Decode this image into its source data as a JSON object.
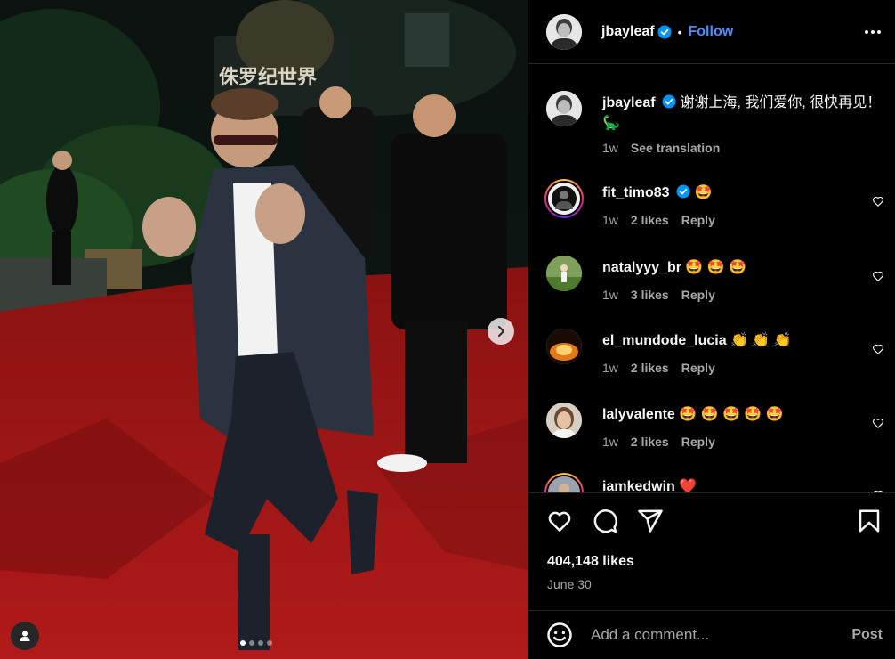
{
  "post": {
    "author": "jbayleaf",
    "follow_label": "Follow",
    "separator": "•",
    "caption_author": "jbayleaf",
    "caption_text": "谢谢上海, 我们爱你, 很快再见！ 🦕",
    "caption_age": "1w",
    "see_translation": "See translation",
    "likes": "404,148 likes",
    "date": "June 30",
    "carousel": {
      "count": 4,
      "active_index": 0
    }
  },
  "photo": {
    "sign_text": "侏罗纪世界"
  },
  "comments": [
    {
      "user": "fit_timo83",
      "verified": true,
      "text": "🤩",
      "age": "1w",
      "likes": "2 likes",
      "reply": "Reply",
      "story_ring": true
    },
    {
      "user": "natalyyy_br",
      "verified": false,
      "text": "🤩 🤩 🤩",
      "age": "1w",
      "likes": "3 likes",
      "reply": "Reply",
      "story_ring": false
    },
    {
      "user": "el_mundode_lucia",
      "verified": false,
      "text": "👏 👏 👏",
      "age": "1w",
      "likes": "2 likes",
      "reply": "Reply",
      "story_ring": false
    },
    {
      "user": "lalyvalente",
      "verified": false,
      "text": "🤩 🤩 🤩 🤩 🤩",
      "age": "1w",
      "likes": "2 likes",
      "reply": "Reply",
      "story_ring": false
    },
    {
      "user": "iamkedwin",
      "verified": false,
      "text": "❤️",
      "age": "",
      "likes": "",
      "reply": "",
      "story_ring": true
    }
  ],
  "composer": {
    "placeholder": "Add a comment...",
    "post_label": "Post"
  },
  "icons": {
    "header_more": "more-horizontal-icon",
    "verified": "verified-badge-icon",
    "like": "heart-icon",
    "comment": "comment-icon",
    "share": "share-icon",
    "save": "bookmark-icon",
    "emoji": "emoji-icon",
    "carousel_next": "chevron-right-icon",
    "tagged": "user-tag-icon"
  },
  "colors": {
    "background": "#000000",
    "link": "#4d8dff",
    "verified": "#0095f6",
    "muted": "#a8a8a8",
    "divider": "#262626",
    "carpet": "#a51616"
  }
}
